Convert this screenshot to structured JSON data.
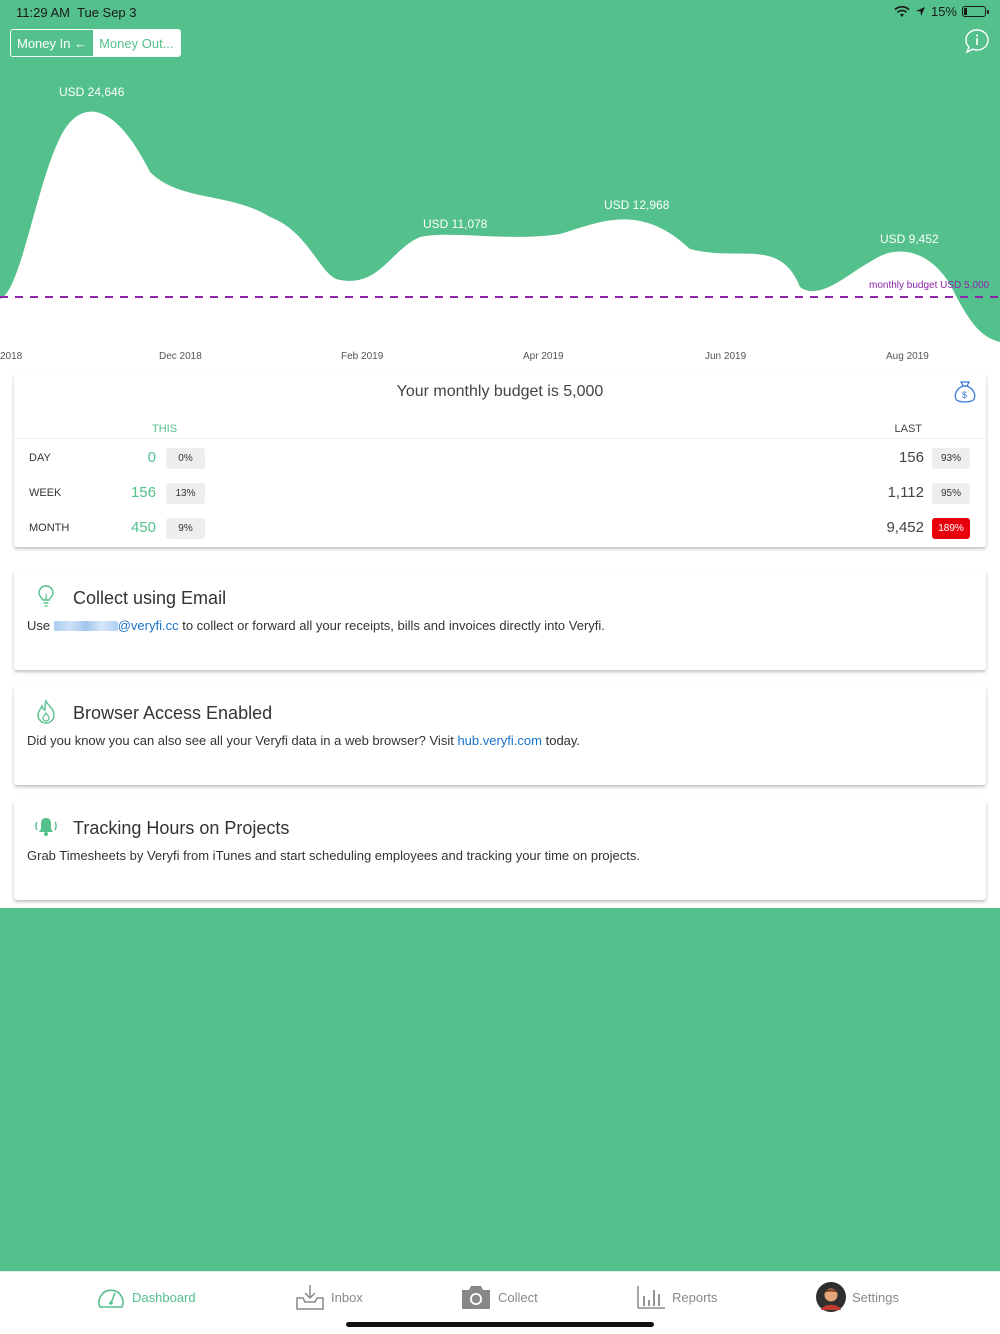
{
  "status": {
    "time": "11:29 AM",
    "date": "Tue Sep 3",
    "battery": "15%"
  },
  "toggle": {
    "money_in": "Money In ←",
    "money_out": "Money Out..."
  },
  "chart_data": {
    "type": "area",
    "x": [
      "Oct 2018",
      "Nov 2018",
      "Dec 2018",
      "Jan 2019",
      "Feb 2019",
      "Mar 2019",
      "Apr 2019",
      "May 2019",
      "Jun 2019",
      "Jul 2019",
      "Aug 2019",
      "Sep 2019"
    ],
    "tick_labels": [
      "2018",
      "Dec 2018",
      "Feb 2019",
      "Apr 2019",
      "Jun 2019",
      "Aug 2019"
    ],
    "values": [
      1500,
      24646,
      16500,
      12500,
      6000,
      11078,
      11000,
      12968,
      9500,
      5000,
      9452,
      1500
    ],
    "annotations": [
      "USD 24,646",
      "USD 11,078",
      "USD 12,968",
      "USD 9,452"
    ],
    "budget_line": {
      "value": 5000,
      "label": "monthly budget USD 5,000"
    },
    "ylim": [
      0,
      28000
    ]
  },
  "budget": {
    "title": "Your monthly budget is 5,000",
    "col_this": "THIS",
    "col_last": "LAST",
    "rows": [
      {
        "label": "DAY",
        "this": "0",
        "this_pct": "0%",
        "last": "156",
        "last_pct": "93%"
      },
      {
        "label": "WEEK",
        "this": "156",
        "this_pct": "13%",
        "last": "1,112",
        "last_pct": "95%"
      },
      {
        "label": "MONTH",
        "this": "450",
        "this_pct": "9%",
        "last": "9,452",
        "last_pct": "189%"
      }
    ]
  },
  "cards": {
    "email": {
      "title": "Collect using Email",
      "pre": "Use ",
      "link": "@veryfi.cc",
      "post": " to collect or forward all your receipts, bills and invoices directly into Veryfi."
    },
    "browser": {
      "title": "Browser Access Enabled",
      "pre": "Did you know you can also see all your Veryfi data in a web browser? Visit ",
      "link": "hub.veryfi.com",
      "post": " today."
    },
    "hours": {
      "title": "Tracking Hours on Projects",
      "body": "Grab Timesheets by Veryfi from iTunes and start scheduling employees and tracking your time on projects."
    }
  },
  "tabs": {
    "dashboard": "Dashboard",
    "inbox": "Inbox",
    "collect": "Collect",
    "reports": "Reports",
    "settings": "Settings"
  },
  "colors": {
    "brand_green": "#54c08b",
    "alert_red": "#e8000c",
    "budget_line": "#8e24aa",
    "link_blue": "#1a73c9"
  }
}
